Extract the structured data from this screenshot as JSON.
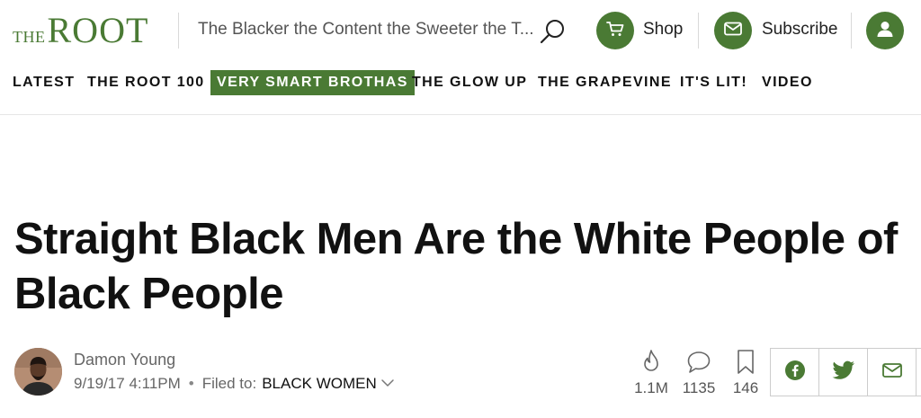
{
  "header": {
    "logo_the": "THE",
    "logo_root": "ROOT",
    "tagline": "The Blacker the Content the Sweeter the T...",
    "shop_label": "Shop",
    "subscribe_label": "Subscribe"
  },
  "nav": {
    "items": [
      {
        "label": "LATEST"
      },
      {
        "label": "THE ROOT 100"
      },
      {
        "label": "VERY SMART BROTHAS",
        "active": true
      },
      {
        "label": "THE GLOW UP"
      },
      {
        "label": "THE GRAPEVINE"
      },
      {
        "label": "IT'S LIT!"
      },
      {
        "label": "VIDEO"
      }
    ]
  },
  "article": {
    "headline": "Straight Black Men Are the White People of Black People",
    "author": "Damon Young",
    "date": "9/19/17 4:11PM",
    "separator": "•",
    "filed_label": "Filed to:",
    "filed_tag": "BLACK WOMEN"
  },
  "stats": {
    "views": "1.1M",
    "comments": "1135",
    "bookmarks": "146"
  },
  "colors": {
    "brand_green": "#4a7a34",
    "text_gray": "#666666"
  },
  "icons": [
    "search-icon",
    "cart-icon",
    "mail-icon",
    "user-icon",
    "flame-icon",
    "comment-icon",
    "bookmark-icon",
    "facebook-icon",
    "twitter-icon",
    "email-icon",
    "chevron-down-icon"
  ]
}
